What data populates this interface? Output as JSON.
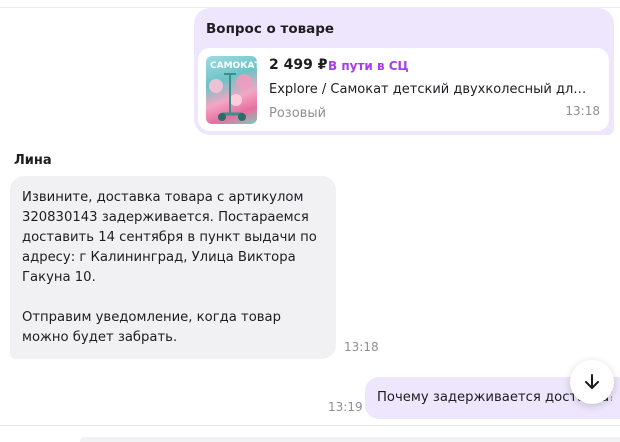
{
  "product_question": {
    "title": "Вопрос о товаре",
    "price": "2 499 ₽",
    "status": "В пути в СЦ",
    "name": "Explore / Самокат детский двухколесный для…",
    "color": "Розовый",
    "time": "13:18",
    "thumbnail_icon": "scooter-product-image"
  },
  "incoming_message": {
    "sender": "Лина",
    "text": "Извините, доставка товара с артикулом 320830143 задерживается. Постараемся доставить 14 сентября в пункт выдачи по адресу: г Калининград, Улица Виктора Гакуна 10.\n\nОтправим уведомление, когда товар можно будет забрать.",
    "time": "13:18"
  },
  "outgoing_message": {
    "text": "Почему задерживается доставка?",
    "time": "13:19"
  },
  "scroll_button": {
    "icon": "arrow-down-icon"
  },
  "colors": {
    "outgoing_bubble": "#eee6fc",
    "incoming_bubble": "#f1f1f4",
    "status_accent": "#a63ee5",
    "muted_text": "#8e8e96"
  }
}
